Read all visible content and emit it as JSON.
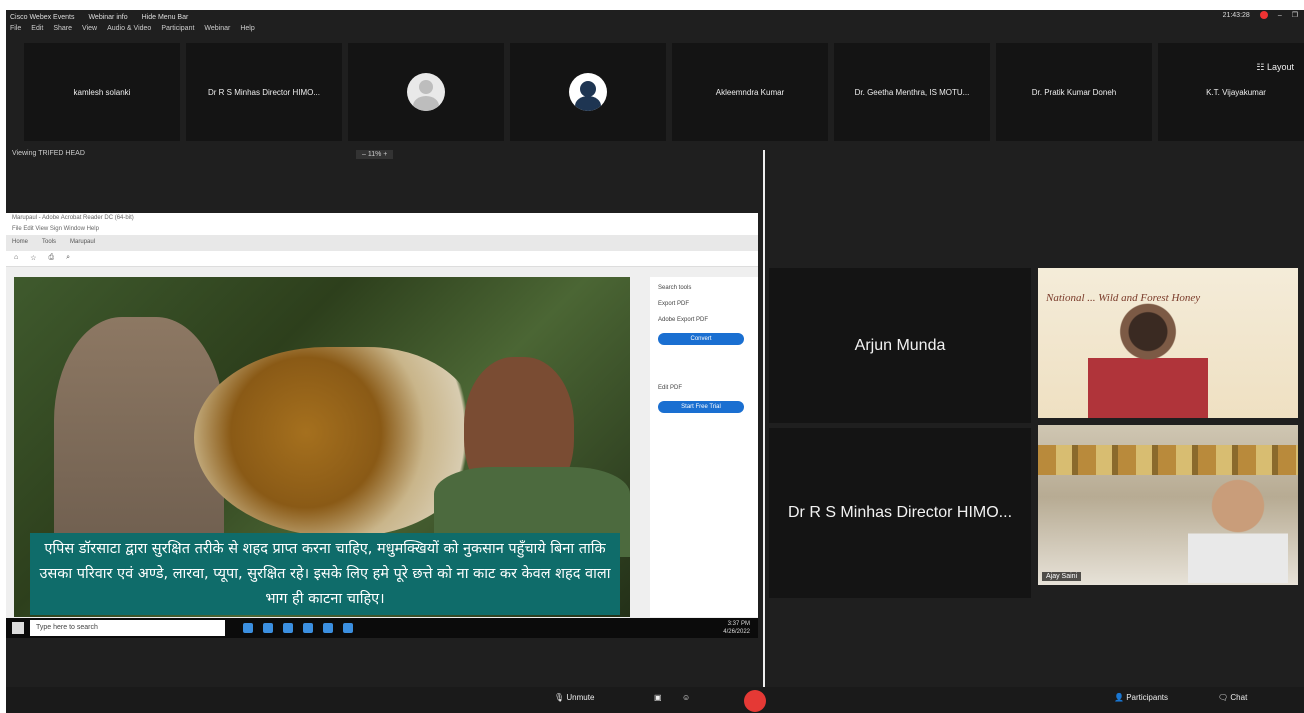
{
  "window": {
    "title_items": [
      "Cisco Webex Events",
      "Webinar info",
      "Hide Menu Bar"
    ],
    "clock": "21:43:28",
    "menu": [
      "File",
      "Edit",
      "Share",
      "View",
      "Audio & Video",
      "Participant",
      "Webinar",
      "Help"
    ]
  },
  "gallery": {
    "tiles": [
      {
        "label": "kamlesh solanki",
        "avatar": null
      },
      {
        "label": "Dr R S Minhas Director HIMO...",
        "avatar": null
      },
      {
        "label": "",
        "avatar": "light"
      },
      {
        "label": "",
        "avatar": "dark"
      },
      {
        "label": "Akleemndra Kumar",
        "avatar": null
      },
      {
        "label": "Dr. Geetha Menthra, IS MOTU...",
        "avatar": null
      },
      {
        "label": "Dr. Pratik Kumar Doneh",
        "avatar": null
      },
      {
        "label": "K.T. Vijayakumar",
        "avatar": null
      }
    ],
    "layout_label": "Layout"
  },
  "share": {
    "viewing_label": "Viewing TRIFED HEAD",
    "zoom": "11%",
    "doc_title": "Marupaul - Adobe Acrobat Reader DC (64-bit)",
    "doc_menu": "File  Edit  View  Sign  Window  Help",
    "doc_tabs": [
      "Home",
      "Tools",
      "Marupaul"
    ],
    "caption": "एपिस डॉरसाटा द्वारा सुरक्षित तरीके से शहद प्राप्त करना चाहिए, मधुमक्खियों को नुकसान पहुँचाये बिना ताकि उसका परिवार एवं अण्डे, लारवा, प्यूपा, सुरक्षित रहे। इसके लिए हमे पूरे छत्ते को ना काट कर केवल शहद वाला भाग ही काटना चाहिए।",
    "pdf_panel": {
      "search": "Search tools",
      "export": "Export PDF",
      "heading": "Adobe Export PDF",
      "convert": "Convert",
      "edit": "Edit PDF",
      "free_trial": "Start Free Trial"
    },
    "taskbar_search": "Type here to search",
    "taskbar_time": "3:37 PM",
    "taskbar_date": "4/26/2022"
  },
  "panels": {
    "name1": "Arjun Munda",
    "name2": "Dr R S Minhas Director HIMO..."
  },
  "videos": {
    "poster_text": "National ... Wild and Forest Honey",
    "person2": "Ajay Saini"
  },
  "toolbar": {
    "unmute": "Unmute",
    "participants": "Participants",
    "chat": "Chat"
  }
}
